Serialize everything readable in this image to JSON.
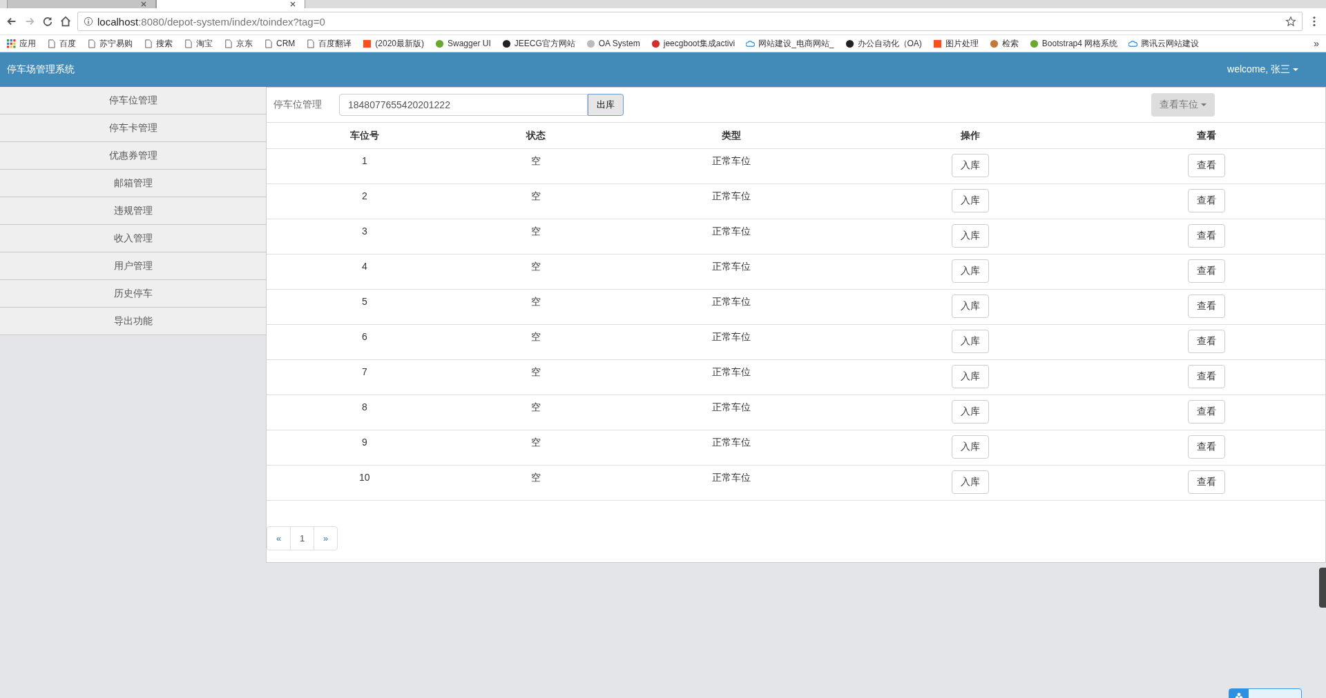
{
  "browser": {
    "tabs": [
      {
        "selected": false
      },
      {
        "selected": true
      }
    ],
    "address": {
      "host": "localhost",
      "path": ":8080/depot-system/index/toindex?tag=0"
    },
    "bookmarks": [
      {
        "label": "应用",
        "kind": "apps"
      },
      {
        "label": "百度",
        "kind": "page"
      },
      {
        "label": "苏宁易购",
        "kind": "page"
      },
      {
        "label": "搜索",
        "kind": "page"
      },
      {
        "label": "淘宝",
        "kind": "page"
      },
      {
        "label": "京东",
        "kind": "page"
      },
      {
        "label": "CRM",
        "kind": "page"
      },
      {
        "label": "百度翻译",
        "kind": "page"
      },
      {
        "label": "(2020最新版)",
        "kind": "orange"
      },
      {
        "label": "Swagger UI",
        "kind": "green"
      },
      {
        "label": "JEECG官方网站",
        "kind": "j"
      },
      {
        "label": "OA System",
        "kind": "globe"
      },
      {
        "label": "jeecgboot集成activi",
        "kind": "red"
      },
      {
        "label": "网站建设_电商网站_",
        "kind": "cloud"
      },
      {
        "label": "办公自动化（OA)",
        "kind": "github"
      },
      {
        "label": "图片处理",
        "kind": "orange"
      },
      {
        "label": "检索",
        "kind": "zhi"
      },
      {
        "label": "Bootstrap4 网格系统",
        "kind": "green"
      },
      {
        "label": "腾讯云网站建设",
        "kind": "cloud"
      }
    ],
    "more": "»"
  },
  "app": {
    "title": "停车场管理系统",
    "user": "welcome, 张三"
  },
  "sidebar": {
    "items": [
      {
        "label": "停车位管理",
        "selected": false
      },
      {
        "label": "停车卡管理",
        "selected": false
      },
      {
        "label": "优惠券管理",
        "selected": false
      },
      {
        "label": "邮箱管理",
        "selected": false
      },
      {
        "label": "违规管理",
        "selected": false
      },
      {
        "label": "收入管理",
        "selected": false
      },
      {
        "label": "用户管理",
        "selected": false
      },
      {
        "label": "历史停车",
        "selected": false
      },
      {
        "label": "导出功能",
        "selected": false
      }
    ]
  },
  "toolbar": {
    "label": "停车位管理",
    "input_value": "1848077655420201222",
    "button": "出库",
    "dropdown": "查看车位"
  },
  "table": {
    "columns": [
      "车位号",
      "状态",
      "类型",
      "操作",
      "查看"
    ],
    "rows": [
      {
        "number": "1",
        "status": "空",
        "type": "正常车位",
        "action": "入库",
        "view": "查看"
      },
      {
        "number": "2",
        "status": "空",
        "type": "正常车位",
        "action": "入库",
        "view": "查看"
      },
      {
        "number": "3",
        "status": "空",
        "type": "正常车位",
        "action": "入库",
        "view": "查看"
      },
      {
        "number": "4",
        "status": "空",
        "type": "正常车位",
        "action": "入库",
        "view": "查看"
      },
      {
        "number": "5",
        "status": "空",
        "type": "正常车位",
        "action": "入库",
        "view": "查看"
      },
      {
        "number": "6",
        "status": "空",
        "type": "正常车位",
        "action": "入库",
        "view": "查看"
      },
      {
        "number": "7",
        "status": "空",
        "type": "正常车位",
        "action": "入库",
        "view": "查看"
      },
      {
        "number": "8",
        "status": "空",
        "type": "正常车位",
        "action": "入库",
        "view": "查看"
      },
      {
        "number": "9",
        "status": "空",
        "type": "正常车位",
        "action": "入库",
        "view": "查看"
      },
      {
        "number": "10",
        "status": "空",
        "type": "正常车位",
        "action": "入库",
        "view": "查看"
      }
    ]
  },
  "pagination": [
    {
      "label": "«",
      "selected": false
    },
    {
      "label": "1",
      "selected": true
    },
    {
      "label": "»",
      "selected": false
    }
  ]
}
